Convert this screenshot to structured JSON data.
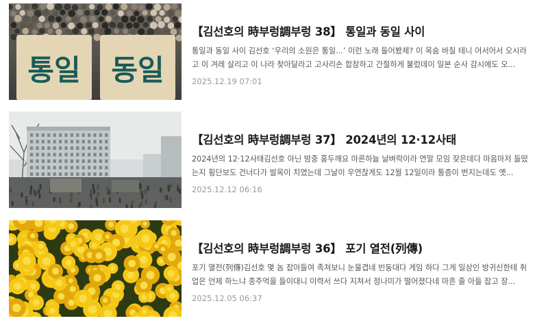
{
  "articles": [
    {
      "thumb_icon": "crowd-banner-photo",
      "thumb_text": [
        "통일",
        "동일"
      ],
      "title": "【김선호의 時부렁調부렁 38】 통일과 동일 사이",
      "summary": "통일과 동일 사이 김선호 ‘우리의 소원은 통일...’ 이런 노래 들어봤제? 이 목숨 바칠 테니 어서어서 오시라고 이 겨레 살리고 이 나라 찾아달라고 고사리손 합창하고 간절하게 불렀데이 일본 순사 감시에도 오...",
      "date": "2025.12.19 07:01"
    },
    {
      "thumb_icon": "military-building-photo",
      "title": "【김선호의 時부렁調부렁 37】 2024년의 12·12사태",
      "summary": "2024년의 12·12사태김선호 아닌 밤중 홍두깨요 마른하늘 날벼락이라 연말 모임 잦은데다 마음마저 들떴는지 횡단보도 건너다가 발목이 치였는데 그날이 우연찮게도 12월 12일이라 통증이 번지는데도 옛...",
      "date": "2025.12.12 06:16"
    },
    {
      "thumb_icon": "yellow-chrysanthemum-photo",
      "title": "【김선호의 時부렁調부렁 36】 포기 열전(列傳)",
      "summary": "포기 열전(列傳)김선호 몇 놈 잡아들여 족쳐보니 눈물겹네 빈둥대다 게임 하다 그게 일상인 방귀신한테 취업은 언제 하느냐 종주먹을 들이대니 이력서 쓰다 지쳐서 정나미가 떨어졌다네 마흔 줄 아들 잡고 장...",
      "date": "2025.12.05 06:37"
    }
  ]
}
